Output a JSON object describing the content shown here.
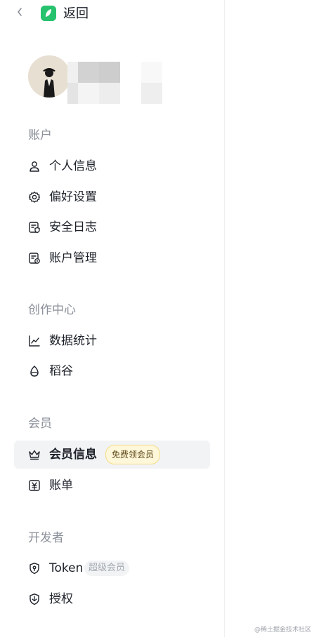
{
  "header": {
    "back_icon": "chevron-left",
    "logo_icon": "juejin-logo",
    "back_label": "返回"
  },
  "profile": {
    "avatar_icon": "user-avatar"
  },
  "sections": {
    "account": {
      "title": "账户",
      "items": [
        {
          "label": "个人信息",
          "icon": "user-icon"
        },
        {
          "label": "偏好设置",
          "icon": "gear-icon"
        },
        {
          "label": "安全日志",
          "icon": "shield-log-icon"
        },
        {
          "label": "账户管理",
          "icon": "account-manage-icon"
        }
      ]
    },
    "creation": {
      "title": "创作中心",
      "items": [
        {
          "label": "数据统计",
          "icon": "line-chart-icon"
        },
        {
          "label": "稻谷",
          "icon": "grain-icon"
        }
      ]
    },
    "membership": {
      "title": "会员",
      "items": [
        {
          "label": "会员信息",
          "icon": "crown-icon",
          "badge": "免费领会员",
          "active": true
        },
        {
          "label": "账单",
          "icon": "bill-icon"
        }
      ]
    },
    "developer": {
      "title": "开发者",
      "items": [
        {
          "label": "Token",
          "icon": "token-shield-icon",
          "badge": "超级会员"
        },
        {
          "label": "授权",
          "icon": "authorize-icon"
        }
      ]
    }
  },
  "watermark": "@稀土掘金技术社区",
  "colors": {
    "accent_green": "#27c26e",
    "active_bg": "#f2f3f5",
    "badge_gold_bg": "#fff7d9",
    "badge_gold_border": "#f5dd8a",
    "section_title": "#8a8f99",
    "text": "#1d2129"
  }
}
